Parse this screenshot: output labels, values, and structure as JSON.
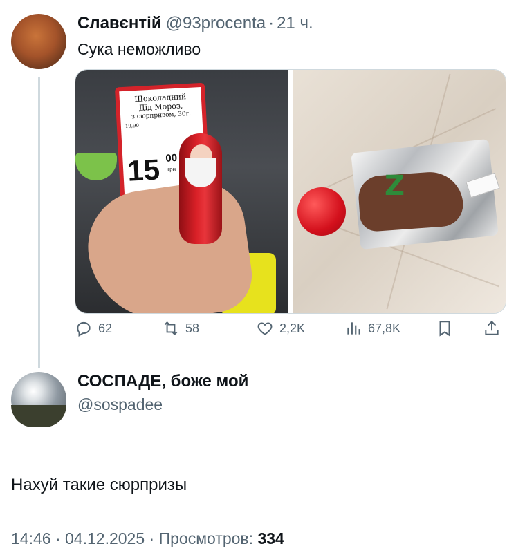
{
  "quoted_tweet": {
    "author_name": "Славєнтій",
    "author_handle": "@93procenta",
    "separator": "·",
    "time": "21 ч.",
    "text": "Сука неможливо",
    "photo1": {
      "price_tag_lines": [
        "Шоколадний",
        "Дід Мороз,",
        "з сюрпризом, 30г.",
        "19,90"
      ],
      "price_main": "15",
      "price_cents": "00",
      "price_currency": "грн"
    },
    "photo2": {
      "toy_letter": "Z"
    },
    "actions": {
      "replies": "62",
      "reposts": "58",
      "likes": "2,2K",
      "views": "67,8K"
    }
  },
  "reply_tweet": {
    "author_name": "СОСПАДЕ, боже мой",
    "author_handle": "@sospadee",
    "text": "Нахуй такие сюрпризы",
    "time": "14:46",
    "date": "04.12.2025",
    "views_label": "Просмотров:",
    "views_count": "334"
  },
  "icons": [
    "reply-icon",
    "repost-icon",
    "like-icon",
    "views-icon",
    "bookmark-icon",
    "share-icon"
  ],
  "colors": {
    "text": "#0f1419",
    "muted": "#536471",
    "border": "#cfd9de"
  }
}
